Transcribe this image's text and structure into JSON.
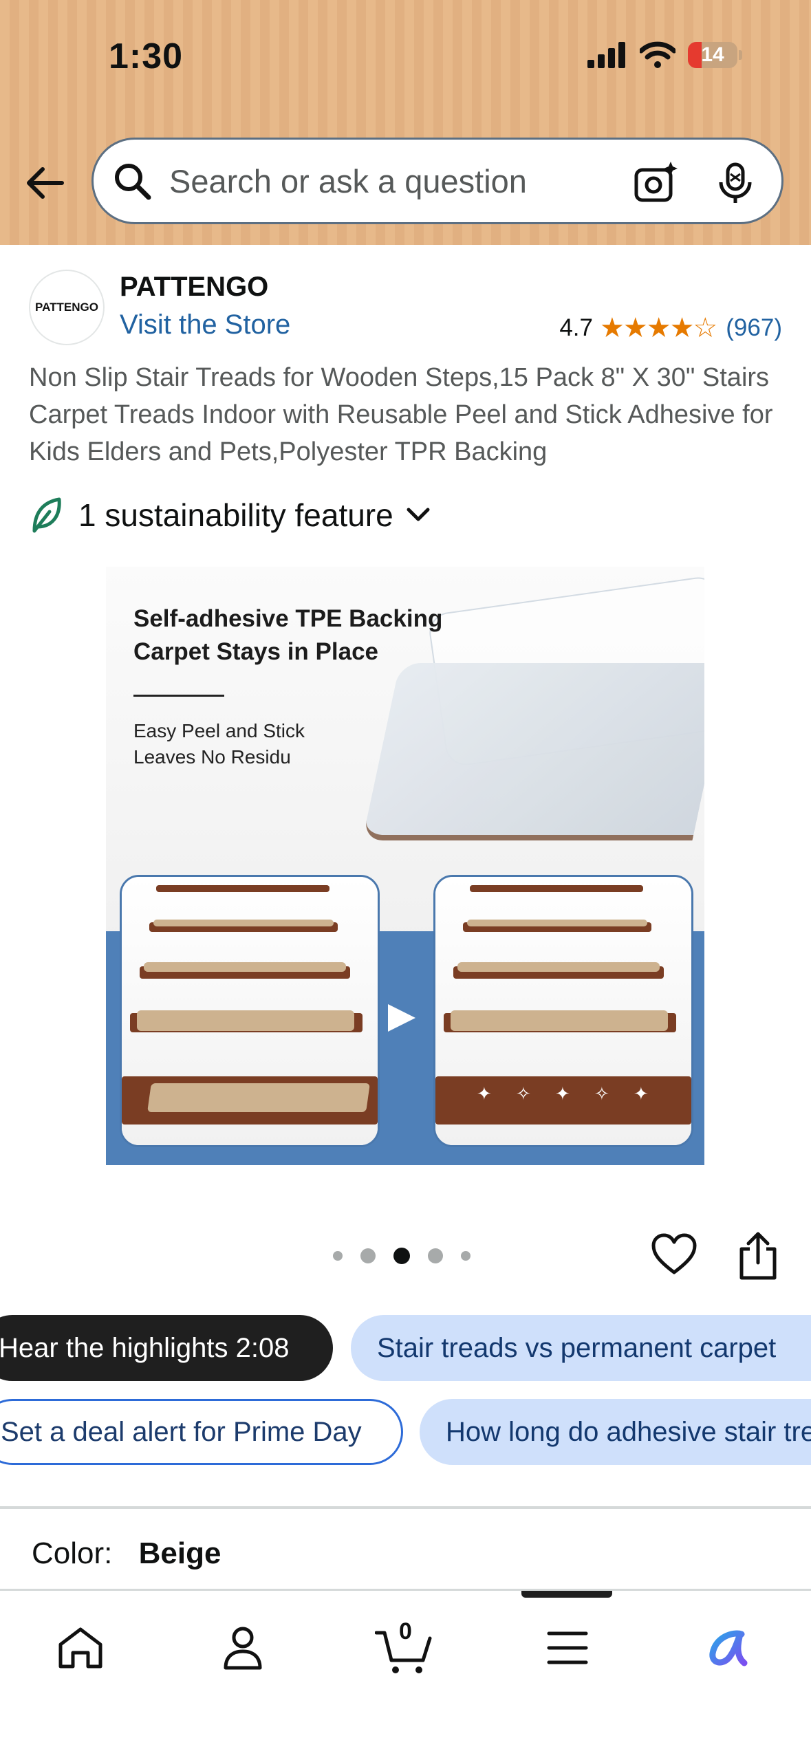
{
  "status_bar": {
    "time": "1:30",
    "battery": "14"
  },
  "search": {
    "placeholder": "Search or ask a question"
  },
  "brand": {
    "logo_text": "PATTENGO",
    "name": "PATTENGO",
    "visit_store": "Visit the Store"
  },
  "rating": {
    "value": "4.7",
    "stars": "★★★★☆",
    "count": "(967)",
    "star_fraction": 0.94
  },
  "product": {
    "title": "Non Slip Stair Treads for Wooden Steps,15 Pack 8\" X 30\" Stairs Carpet Treads Indoor with Reusable Peel and Stick Adhesive for Kids Elders and Pets,Polyester TPR Backing",
    "sustainability": "1 sustainability feature",
    "image": {
      "heading_line1": "Self-adhesive TPE Backing",
      "heading_line2": "Carpet Stays in Place",
      "sub_line1": "Easy Peel and Stick",
      "sub_line2": "Leaves No Residu"
    },
    "image_carousel": {
      "total": 5,
      "active": 3
    }
  },
  "chips": {
    "highlights": "Hear the highlights 2:08",
    "compare": "Stair treads vs permanent carpet",
    "deal_alert": "Set a deal alert for Prime Day",
    "question": "How long do adhesive stair treads last?"
  },
  "variation": {
    "label": "Color:",
    "value": "Beige"
  },
  "bottom_nav": {
    "cart_count": "0"
  },
  "colors": {
    "accent_blue": "#2162a1",
    "star_orange": "#e67a00",
    "header_bg": "#e7b98a"
  }
}
